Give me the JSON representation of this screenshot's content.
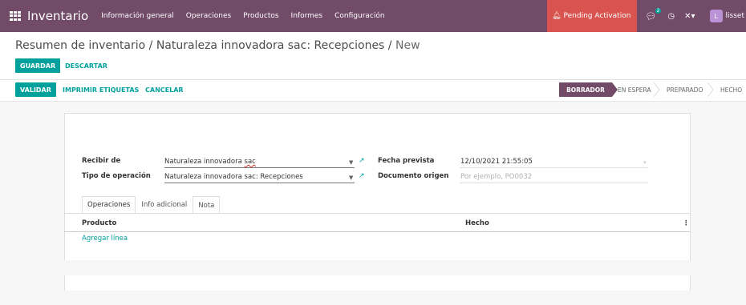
{
  "navbar": {
    "apps_icon": "apps-grid-icon",
    "brand": "Inventario",
    "menu": [
      "Información general",
      "Operaciones",
      "Productos",
      "Informes",
      "Configuración"
    ],
    "pending": "Pending Activation",
    "chat_badge": "2",
    "avatar_letter": "L",
    "user": "lisset",
    "colors": {
      "bar": "#714B67",
      "pending": "#d9534f"
    }
  },
  "breadcrumb": {
    "parent": "Resumen de inventario / Naturaleza innovadora sac: Recepciones",
    "separator": " / ",
    "current": "New"
  },
  "actions": {
    "save": "GUARDAR",
    "discard": "DESCARTAR"
  },
  "toolbar": {
    "validate": "VALIDAR",
    "print_labels": "IMPRIMIR ETIQUETAS",
    "cancel": "CANCELAR"
  },
  "status": {
    "active": "BORRADOR",
    "items": [
      "EN ESPERA",
      "PREPARADO",
      "HECHO"
    ]
  },
  "form": {
    "receive_from_label": "Recibir de",
    "receive_from_value_main": "Naturaleza innovadora ",
    "receive_from_value_tail": "sac",
    "operation_type_label": "Tipo de operación",
    "operation_type_value": "Naturaleza innovadora sac: Recepciones",
    "scheduled_label": "Fecha prevista",
    "scheduled_value": "12/10/2021 21:55:05",
    "source_doc_label": "Documento origen",
    "source_doc_placeholder": "Por ejemplo, PO0032"
  },
  "tabs": [
    "Operaciones",
    "Info adicional",
    "Nota"
  ],
  "table": {
    "columns": [
      "Producto",
      "Hecho"
    ],
    "add_line": "Agregar línea"
  },
  "accent": "#00A09D"
}
